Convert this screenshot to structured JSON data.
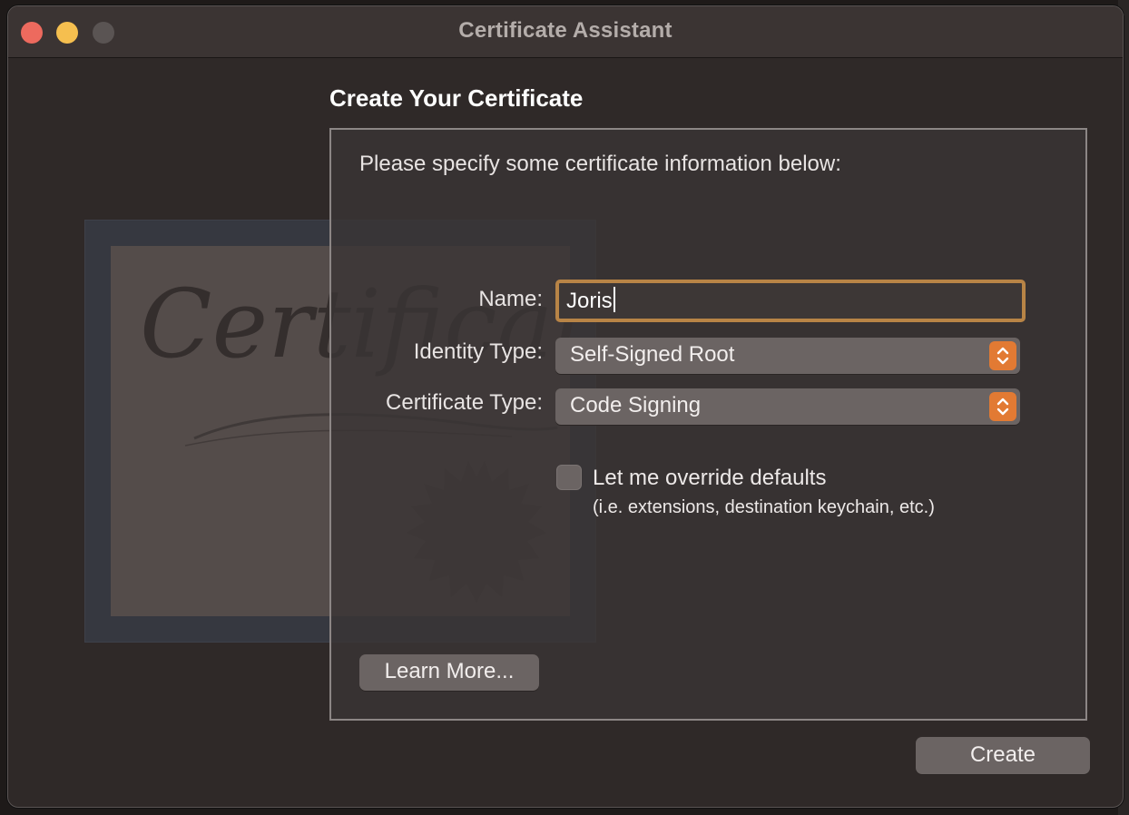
{
  "window": {
    "title": "Certificate Assistant",
    "controls": [
      "close",
      "minimize",
      "zoom"
    ],
    "colors": {
      "close": "#ed6a5e",
      "minimize": "#f5bf4f",
      "accent": "#e27a33",
      "focus_ring": "#b88446"
    }
  },
  "illustration": {
    "script_text": "Certificate"
  },
  "page": {
    "heading": "Create Your Certificate",
    "intro": "Please specify some certificate information below:"
  },
  "form": {
    "name_label": "Name:",
    "name_value": "Joris",
    "identity_label": "Identity Type:",
    "identity_value": "Self-Signed Root",
    "cert_type_label": "Certificate Type:",
    "cert_type_value": "Code Signing",
    "override_label": "Let me override defaults",
    "override_checked": false,
    "override_hint": "(i.e. extensions, destination keychain, etc.)"
  },
  "buttons": {
    "learn_more": "Learn More...",
    "create": "Create"
  },
  "icons": {
    "popup_stepper": "chevron-up-down-icon"
  }
}
